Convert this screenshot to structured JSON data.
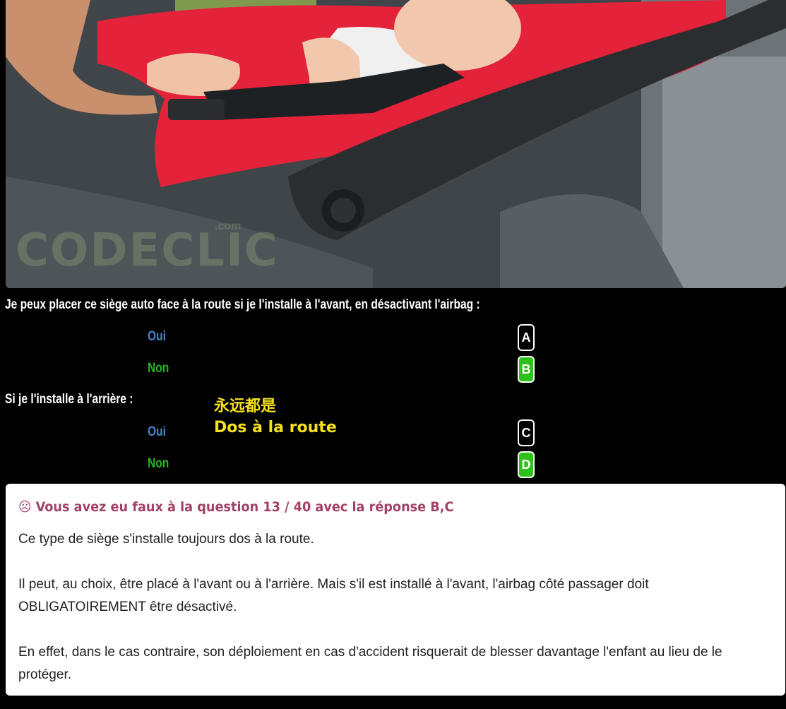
{
  "photo": {
    "watermark": "CODECLIC",
    "watermark_suffix": ".com",
    "alt_icon": "baby-car-seat-photo"
  },
  "question": {
    "q1_text": "Je peux placer ce siège auto face à la route si je l'installe à l'avant, en désactivant l'airbag :",
    "q2_text": "Si je l'installe à l'arrière :",
    "answers": [
      {
        "label": "Oui",
        "key": "A",
        "correct": false
      },
      {
        "label": "Non",
        "key": "B",
        "correct": true
      },
      {
        "label": "Oui",
        "key": "C",
        "correct": false
      },
      {
        "label": "Non",
        "key": "D",
        "correct": true
      }
    ],
    "annotation_line1": "永远都是",
    "annotation_line2": "Dos à la route"
  },
  "result": {
    "icon": "☹",
    "heading": "Vous avez eu faux à la question 13 / 40 avec la réponse B,C",
    "paragraphs": [
      "Ce type de siège s'installe toujours dos à la route.",
      "Il peut, au choix, être placé à l'avant ou à l'arrière. Mais s'il est installé à l'avant, l'airbag côté passager doit OBLIGATOIREMENT être désactivé.",
      "En effet, dans le cas contraire, son déploiement en cas d'accident risquerait de blesser davantage l'enfant au lieu de le protéger."
    ],
    "colors": {
      "heading": "#a24168",
      "correct_key": "#2ec11b",
      "oui": "#4a83c9",
      "non": "#22b722"
    }
  }
}
